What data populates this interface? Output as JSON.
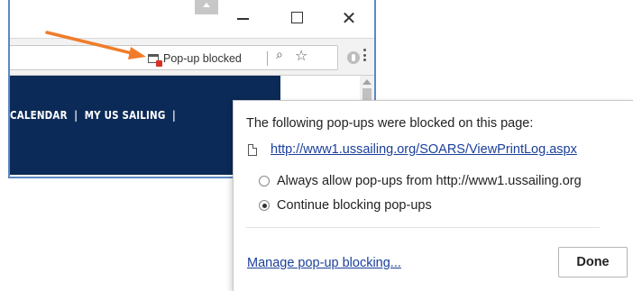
{
  "titlebar": {
    "minimize_symbol": "",
    "maximize_symbol": "",
    "close_symbol": "✕"
  },
  "addressbar": {
    "popup_blocked_label": "Pop-up blocked",
    "zoom_icon": "🔍",
    "star_icon": "☆"
  },
  "page": {
    "nav_items": [
      "CALENDAR",
      "MY US SAILING"
    ],
    "nav_separator": "|"
  },
  "popup_bubble": {
    "heading": "The following pop-ups were blocked on this page:",
    "blocked_url": "http://www1.ussailing.org/SOARS/ViewPrintLog.aspx",
    "options": [
      {
        "label": "Always allow pop-ups from http://www1.ussailing.org",
        "checked": false
      },
      {
        "label": "Continue blocking pop-ups",
        "checked": true
      }
    ],
    "manage_link": "Manage pop-up blocking...",
    "done_label": "Done"
  },
  "colors": {
    "nav_band": "#0b2a57",
    "link": "#1a3f9b",
    "annotation_arrow": "#f07c2a",
    "window_border": "#5b89c4",
    "blocked_badge": "#d93025"
  }
}
